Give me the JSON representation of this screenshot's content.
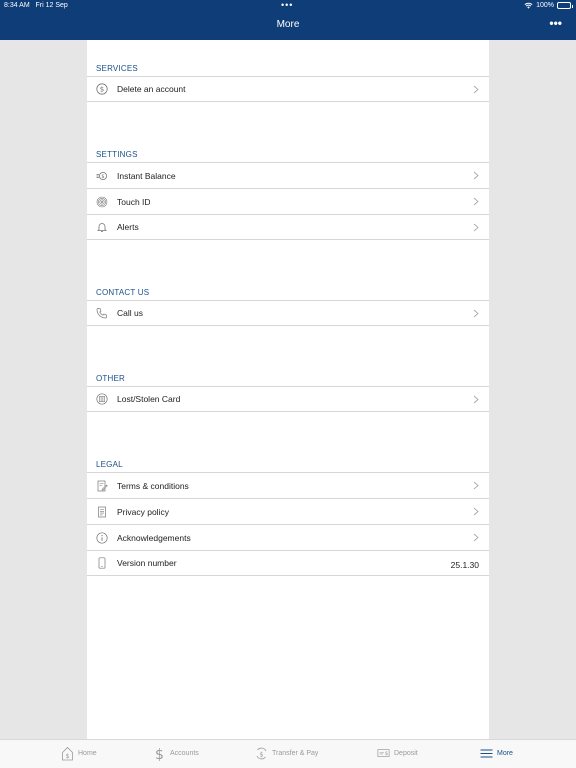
{
  "status_bar": {
    "time": "8:34 AM",
    "date": "Fri 12 Sep",
    "dots": "•••",
    "battery": "100%"
  },
  "header": {
    "title": "More",
    "more_icon": "ellipsis-icon"
  },
  "sections": [
    {
      "title": "SERVICES",
      "rows": [
        {
          "label": "Delete an account",
          "icon": "dollar-circle-icon"
        }
      ]
    },
    {
      "title": "SETTINGS",
      "rows": [
        {
          "label": "Instant Balance",
          "icon": "instant-balance-icon"
        },
        {
          "label": "Touch ID",
          "icon": "fingerprint-icon"
        },
        {
          "label": "Alerts",
          "icon": "bell-icon"
        }
      ]
    },
    {
      "title": "CONTACT US",
      "rows": [
        {
          "label": "Call us",
          "icon": "phone-icon"
        }
      ]
    },
    {
      "title": "OTHER",
      "rows": [
        {
          "label": "Lost/Stolen Card",
          "icon": "card-icon"
        }
      ]
    },
    {
      "title": "LEGAL",
      "rows": [
        {
          "label": "Terms & conditions",
          "icon": "document-pen-icon"
        },
        {
          "label": "Privacy policy",
          "icon": "document-icon"
        },
        {
          "label": "Acknowledgements",
          "icon": "info-icon"
        },
        {
          "label": "Version number",
          "icon": "phone-device-icon",
          "value": "25.1.30"
        }
      ]
    }
  ],
  "tabbar": {
    "home": "Home",
    "accounts": "Accounts",
    "transfer": "Transfer & Pay",
    "deposit": "Deposit",
    "more": "More",
    "active": "more"
  },
  "colors": {
    "header_bg": "#0f3d77",
    "accent": "#1a4f8c",
    "page_bg": "#e6e6e6"
  }
}
